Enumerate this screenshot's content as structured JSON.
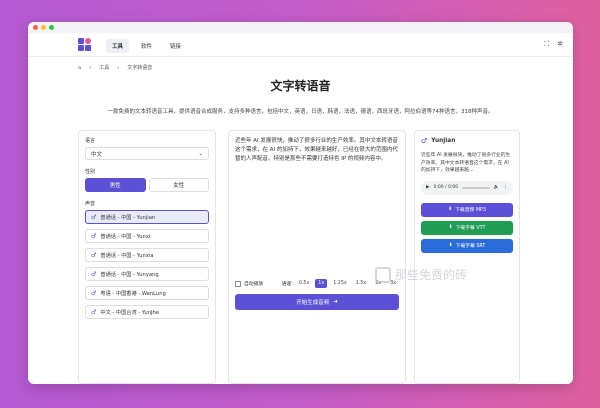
{
  "nav": {
    "links": [
      "工具",
      "软件",
      "链接"
    ]
  },
  "breadcrumb": {
    "tools": "工具",
    "current": "文字转语音"
  },
  "page": {
    "title": "文字转语音",
    "subtitle": "一款免费的文本转语音工具，提供语音合成服务，支持多种语言，包括中文，英语，日语，韩语，法语，德语，西班牙语，阿拉伯语等74种语言，318种声音。"
  },
  "left": {
    "language_label": "语言",
    "language_value": "中文",
    "gender_label": "性别",
    "gender_male": "男性",
    "gender_female": "女性",
    "voice_label": "声音",
    "voices": [
      "普通话 - 中国 - Yunjian",
      "普通话 - 中国 - Yunxi",
      "普通话 - 中国 - Yunxia",
      "普通话 - 中国 - Yunyang",
      "粤语 - 中国香港 - WanLung",
      "中文 - 中国台湾 - YunJhe"
    ]
  },
  "mid": {
    "text": "近些年 AI 发展很快，推动了很多行业的生产效率。其中文本转语音这个需求，在 AI 的加持下，效果越来越好，已经在很大的范围内代替的人声配音。特别是那些不需要打造特色 IP 的视频内容中。",
    "autoplay": "自动播放",
    "speed_label": "语速:",
    "speeds": [
      "0.5x",
      "1x",
      "1.25x",
      "1.5x",
      "2x",
      "3x"
    ],
    "generate": "开始生成音频"
  },
  "right": {
    "name": "Yunjian",
    "text": "近些年 AI 发展很快，推动了很多行业的生产效率。其中文本转语音这个需求，在 AI 的加持下，效果越来越...",
    "time": "0:00 / 0:00",
    "dl_mp3": "下载音频 MP3",
    "dl_vtt": "下载字幕 VTT",
    "dl_srt": "下载字幕 SRT"
  },
  "watermark": "那些免费的砖",
  "colors": {
    "accent": "#5b50d6",
    "green": "#1f9d55",
    "blue": "#2b6cd8"
  }
}
